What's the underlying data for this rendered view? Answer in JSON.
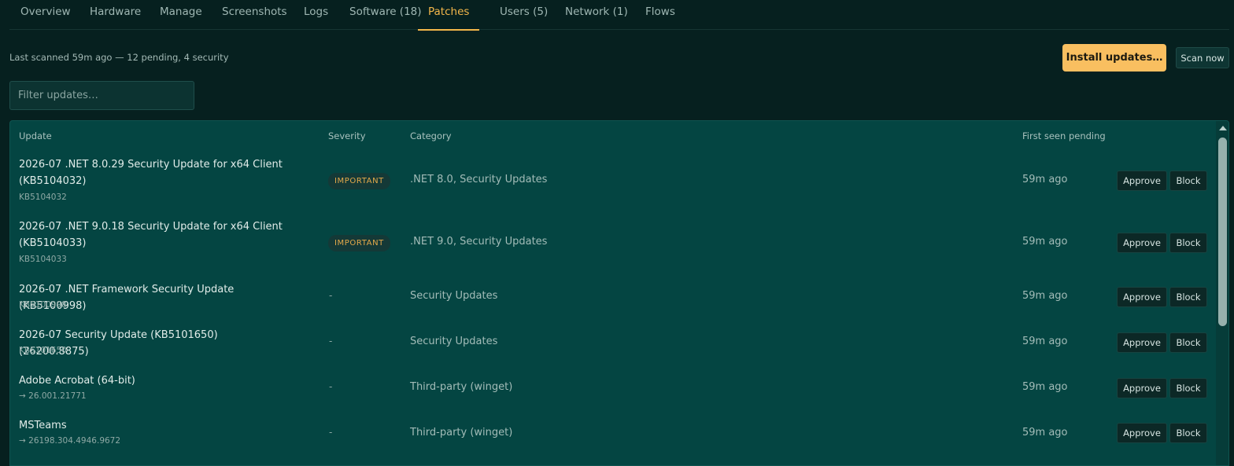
{
  "tabs": [
    {
      "label": "Overview"
    },
    {
      "label": "Hardware"
    },
    {
      "label": "Manage"
    },
    {
      "label": "Screenshots"
    },
    {
      "label": "Logs"
    },
    {
      "label": "Software (18)"
    },
    {
      "label": "Patches"
    },
    {
      "label": "Users (5)"
    },
    {
      "label": "Network (1)"
    },
    {
      "label": "Flows"
    }
  ],
  "active_tab": "Patches",
  "status": "Last scanned 59m ago — 12 pending, 4 security",
  "actions": {
    "install": "Install updates…",
    "scan": "Scan now"
  },
  "filter": {
    "placeholder": "Filter updates…",
    "value": ""
  },
  "table": {
    "headers": {
      "update": "Update",
      "severity": "Severity",
      "category": "Category",
      "first_seen": "First seen pending"
    },
    "rows": [
      {
        "title": "2026-07 .NET 8.0.29 Security Update for x64 Client (KB5104032)",
        "sub": "KB5104032",
        "severity": "IMPORTANT",
        "category": ".NET 8.0, Security Updates",
        "seen": "59m ago",
        "approve": "Approve",
        "block": "Block"
      },
      {
        "title": "2026-07 .NET 9.0.18 Security Update for x64 Client (KB5104033)",
        "sub": "KB5104033",
        "severity": "IMPORTANT",
        "category": ".NET 9.0, Security Updates",
        "seen": "59m ago",
        "approve": "Approve",
        "block": "Block"
      },
      {
        "title": "2026-07 .NET Framework Security Update (KB5100998)",
        "sub": "KB5100998",
        "severity": "-",
        "category": "Security Updates",
        "seen": "59m ago",
        "approve": "Approve",
        "block": "Block"
      },
      {
        "title": "2026-07 Security Update (KB5101650) (26200.8875)",
        "sub": "KB5101650",
        "severity": "-",
        "category": "Security Updates",
        "seen": "59m ago",
        "approve": "Approve",
        "block": "Block"
      },
      {
        "title": "Adobe Acrobat (64-bit)",
        "sub": "→ 26.001.21771",
        "severity": "-",
        "category": "Third-party (winget)",
        "seen": "59m ago",
        "approve": "Approve",
        "block": "Block"
      },
      {
        "title": "MSTeams",
        "sub": "→ 26198.304.4946.9672",
        "severity": "-",
        "category": "Third-party (winget)",
        "seen": "59m ago",
        "approve": "Approve",
        "block": "Block"
      }
    ]
  },
  "colors": {
    "accent": "#f2b64a",
    "background": "#06201f",
    "panel": "#044542"
  }
}
